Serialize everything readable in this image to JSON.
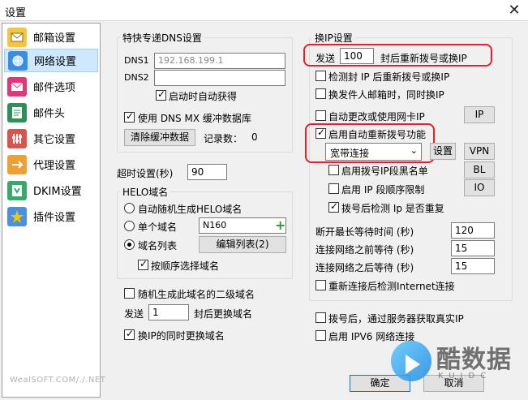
{
  "window": {
    "title": "设置",
    "close_glyph": "✕"
  },
  "sidebar": {
    "items": [
      {
        "label": "邮箱设置",
        "icon": "mailbox-icon",
        "color": "#f4c542"
      },
      {
        "label": "网络设置",
        "icon": "network-icon",
        "color": "#3c8dde",
        "active": true
      },
      {
        "label": "邮件选项",
        "icon": "mail-options-icon",
        "color": "#e0367a"
      },
      {
        "label": "邮件头",
        "icon": "mail-header-icon",
        "color": "#2f8f5b"
      },
      {
        "label": "其它设置",
        "icon": "other-settings-icon",
        "color": "#d9534f"
      },
      {
        "label": "代理设置",
        "icon": "proxy-icon",
        "color": "#f0a030"
      },
      {
        "label": "DKIM设置",
        "icon": "dkim-icon",
        "color": "#3aa86b"
      },
      {
        "label": "插件设置",
        "icon": "plugin-icon",
        "color": "#f5b400"
      }
    ],
    "footer": "WealSOFT.COM/./.NET"
  },
  "dns": {
    "title": "特快专递DNS设置",
    "dns1_label": "DNS1",
    "dns1_value": "192.168.199.1",
    "dns2_label": "DNS2",
    "dns2_value": "",
    "auto_get_label": "启动时自动获得",
    "use_mx_cache_label": "使用 DNS MX 缓冲数据库",
    "clear_cache_button": "清除缓冲数据",
    "record_count_label": "记录数：",
    "record_count_value": "0"
  },
  "timeout": {
    "label": "超时设置(秒)",
    "value": "90"
  },
  "helo": {
    "title": "HELO域名",
    "radio_auto": "自动随机生成HELO域名",
    "radio_single": "单个域名",
    "single_value": "N160",
    "radio_list": "域名列表",
    "edit_list_button": "编辑列表(2)",
    "sequential_label": "按顺序选择域名",
    "random_subdomain_label": "随机生成此域名的二级域名",
    "send_label": "发送",
    "send_value": "1",
    "send_suffix": "封后更换域名",
    "change_on_ip_label": "换IP的同时更换域名"
  },
  "ip_change": {
    "title": "换IP设置",
    "send_label": "发送",
    "send_value": "100",
    "send_suffix": "封后重新拨号或换IP",
    "detect_blocked_label": "检测封 IP 后重新拨号或换IP",
    "mailbox_change_label": "换发件人邮箱时，同时换IP",
    "auto_nic_label": "自动更改或使用网卡IP",
    "ip_button": "IP",
    "auto_redial_label": "启用自动重新拨号功能",
    "connection_value": "宽带连接",
    "settings_button": "设置",
    "vpn_button": "VPN",
    "ip_blacklist_label": "启用拨号IP段黑名单",
    "bl_button": "BL",
    "ip_order_label": "启用 IP 段顺序限制",
    "io_button": "IO",
    "check_duplicate_label": "拨号后检测 Ip 是否重复",
    "max_disconnect_label": "断开最长等待时间 (秒)",
    "max_disconnect_value": "120",
    "before_connect_label": "连接网络之前等待 (秒)",
    "before_connect_value": "15",
    "after_connect_label": "连接网络之后等待 (秒)",
    "after_connect_value": "15",
    "recheck_internet_label": "重新连接后检测Internet连接",
    "get_real_ip_label": "拨号后，通过服务器获取真实IP",
    "ipv6_label": "启用 IPV6 网络连接"
  },
  "footer_buttons": {
    "ok": "确定",
    "cancel": "取消"
  },
  "watermark": {
    "text": "酷数据",
    "sub": "KUIDC"
  },
  "colors": {
    "highlight_box": "#e0202a",
    "active_item": "#cde8ff"
  }
}
